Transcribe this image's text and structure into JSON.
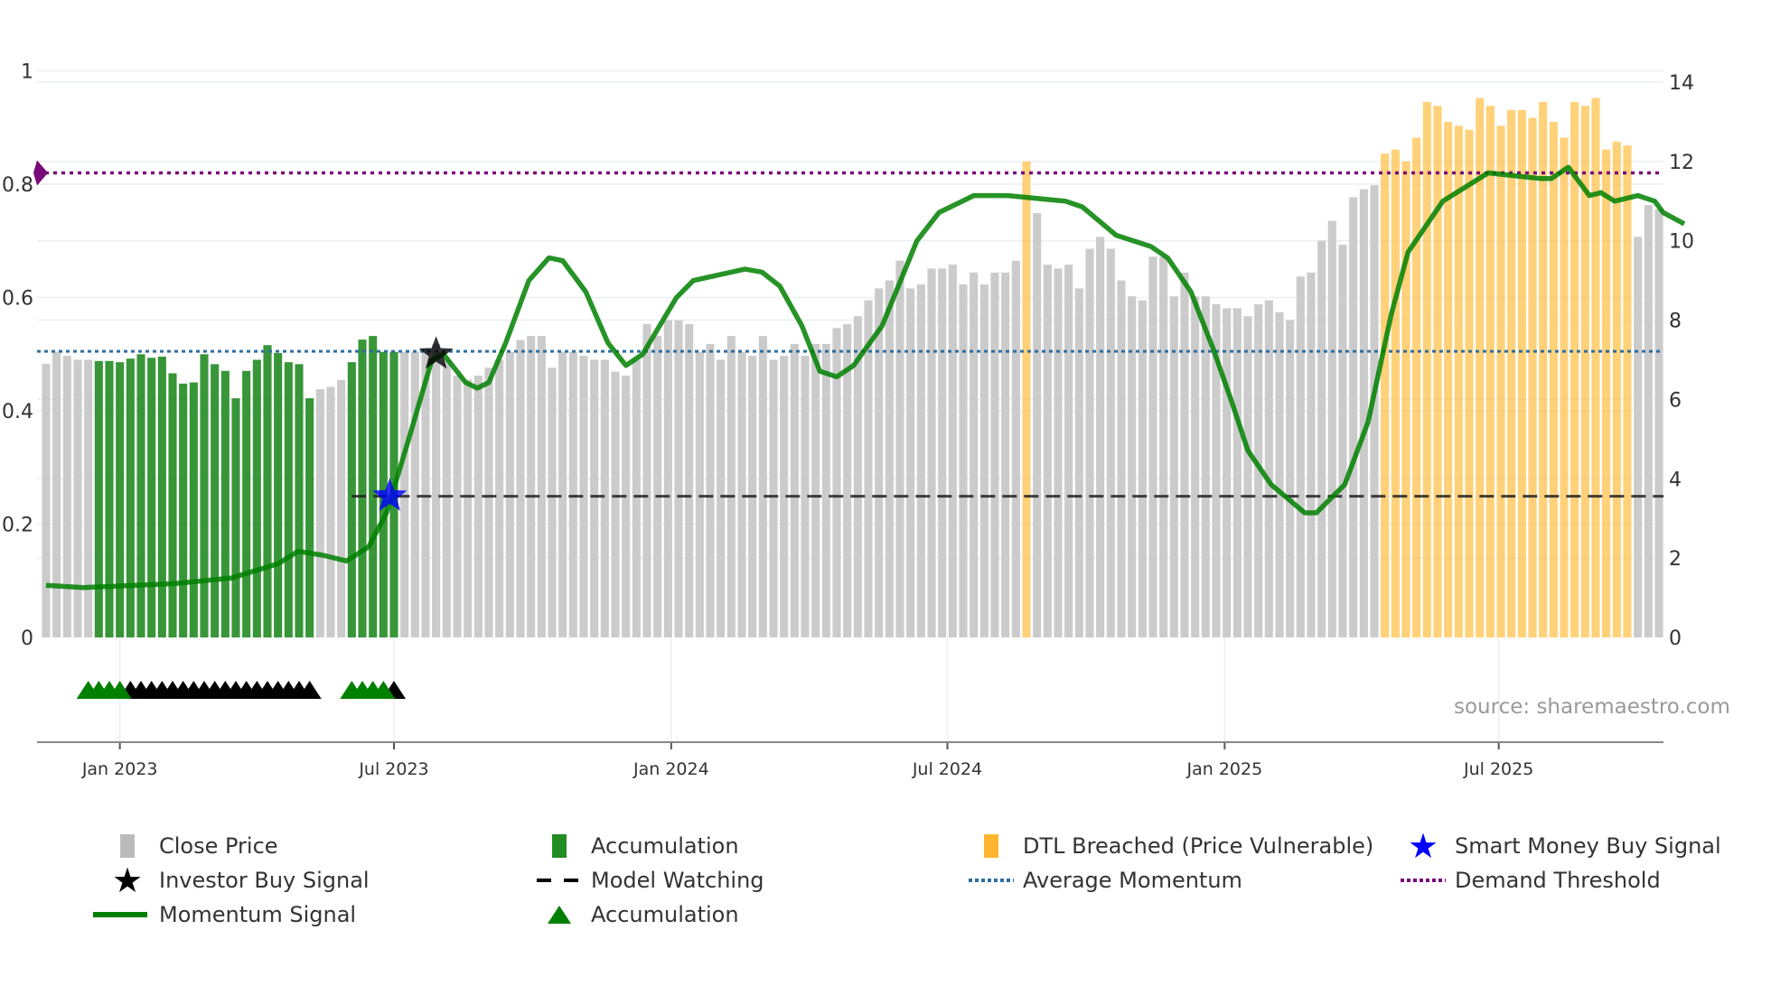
{
  "chart_data": {
    "type": "bar",
    "title": "",
    "start_week": "2022-11-14",
    "frequency": "weekly",
    "x_ticks": [
      {
        "label": "Jan 2023",
        "week": 7
      },
      {
        "label": "Jul 2023",
        "week": 33
      },
      {
        "label": "Jan 2024",
        "week": 59.3
      },
      {
        "label": "Jul 2024",
        "week": 85.5
      },
      {
        "label": "Jan 2025",
        "week": 111.8
      },
      {
        "label": "Jul 2025",
        "week": 137.8
      }
    ],
    "left_axis": {
      "ylim": [
        0,
        1
      ],
      "ticks": [
        "0",
        "0.2",
        "0.4",
        "0.6",
        "0.8",
        "1"
      ]
    },
    "right_axis": {
      "ylim": [
        0,
        14
      ],
      "ticks": [
        "0",
        "2",
        "4",
        "6",
        "8",
        "10",
        "12",
        "14"
      ]
    },
    "prices": [
      6.9,
      7.2,
      7.1,
      7.0,
      7.0,
      6.97,
      6.97,
      6.94,
      7.03,
      7.14,
      7.05,
      7.08,
      6.66,
      6.4,
      6.43,
      7.14,
      6.89,
      6.72,
      6.03,
      6.72,
      7.0,
      7.37,
      7.17,
      6.94,
      6.89,
      6.03,
      6.26,
      6.32,
      6.49,
      6.94,
      7.51,
      7.6,
      7.2,
      7.2,
      7.2,
      7.2,
      7.3,
      7.4,
      7.0,
      6.6,
      6.5,
      6.6,
      6.8,
      7.0,
      7.2,
      7.5,
      7.6,
      7.6,
      6.8,
      7.2,
      7.2,
      7.1,
      7.0,
      7.0,
      6.7,
      6.6,
      7.0,
      7.9,
      7.6,
      8.0,
      8.0,
      7.9,
      7.2,
      7.4,
      7.0,
      7.6,
      7.2,
      7.1,
      7.6,
      7.0,
      7.1,
      7.4,
      7.1,
      7.4,
      7.4,
      7.8,
      7.9,
      8.1,
      8.5,
      8.8,
      9.0,
      9.5,
      8.8,
      8.9,
      9.3,
      9.3,
      9.4,
      8.9,
      9.2,
      8.9,
      9.2,
      9.2,
      9.5,
      12.0,
      10.7,
      9.4,
      9.3,
      9.4,
      8.8,
      9.8,
      10.1,
      9.8,
      9.0,
      8.6,
      8.5,
      9.6,
      9.6,
      8.6,
      9.2,
      8.6,
      8.6,
      8.4,
      8.3,
      8.3,
      8.1,
      8.4,
      8.5,
      8.2,
      8.0,
      9.1,
      9.2,
      10.0,
      10.5,
      9.9,
      11.1,
      11.3,
      11.4,
      12.2,
      12.3,
      12.0,
      12.6,
      13.5,
      13.4,
      13.0,
      12.9,
      12.8,
      13.6,
      13.4,
      12.9,
      13.3,
      13.3,
      13.1,
      13.5,
      13.0,
      12.6,
      13.5,
      13.4,
      13.6,
      12.3,
      12.5,
      12.4,
      10.1,
      10.9,
      10.8
    ],
    "bar_categories": {
      "accumulation_weeks": [
        [
          5,
          25
        ],
        [
          29,
          33
        ]
      ],
      "dtl_breached_weeks": [
        [
          93,
          93
        ],
        [
          127,
          150
        ]
      ]
    },
    "momentum": [
      [
        0,
        0.092
      ],
      [
        3.5,
        0.088
      ],
      [
        12.2,
        0.095
      ],
      [
        17.6,
        0.105
      ],
      [
        22,
        0.13
      ],
      [
        23.9,
        0.152
      ],
      [
        26.3,
        0.145
      ],
      [
        28.5,
        0.135
      ],
      [
        30.6,
        0.16
      ],
      [
        32.3,
        0.22
      ],
      [
        34.4,
        0.35
      ],
      [
        36.6,
        0.49
      ],
      [
        37.7,
        0.5
      ],
      [
        39.8,
        0.45
      ],
      [
        40.9,
        0.44
      ],
      [
        42,
        0.45
      ],
      [
        43.6,
        0.52
      ],
      [
        45.8,
        0.63
      ],
      [
        47.7,
        0.67
      ],
      [
        49,
        0.665
      ],
      [
        51.2,
        0.61
      ],
      [
        53.3,
        0.52
      ],
      [
        55,
        0.48
      ],
      [
        56.6,
        0.5
      ],
      [
        59.8,
        0.6
      ],
      [
        61.4,
        0.63
      ],
      [
        66.3,
        0.65
      ],
      [
        67.9,
        0.645
      ],
      [
        69.6,
        0.62
      ],
      [
        71.7,
        0.55
      ],
      [
        73.4,
        0.47
      ],
      [
        75,
        0.46
      ],
      [
        76.6,
        0.48
      ],
      [
        79.3,
        0.55
      ],
      [
        82.6,
        0.7
      ],
      [
        84.7,
        0.75
      ],
      [
        88,
        0.78
      ],
      [
        91.2,
        0.78
      ],
      [
        96.7,
        0.77
      ],
      [
        98.3,
        0.76
      ],
      [
        101.5,
        0.71
      ],
      [
        104.8,
        0.69
      ],
      [
        106.4,
        0.67
      ],
      [
        108.6,
        0.61
      ],
      [
        110.7,
        0.51
      ],
      [
        112.4,
        0.42
      ],
      [
        114,
        0.33
      ],
      [
        116.2,
        0.27
      ],
      [
        119.4,
        0.22
      ],
      [
        120.5,
        0.22
      ],
      [
        123.2,
        0.27
      ],
      [
        125.4,
        0.38
      ],
      [
        127.6,
        0.57
      ],
      [
        129.2,
        0.68
      ],
      [
        132.5,
        0.77
      ],
      [
        136.8,
        0.82
      ],
      [
        141.7,
        0.81
      ],
      [
        142.8,
        0.81
      ],
      [
        144.4,
        0.83
      ],
      [
        146.4,
        0.78
      ],
      [
        147.5,
        0.785
      ],
      [
        148.8,
        0.77
      ],
      [
        151,
        0.78
      ],
      [
        152.6,
        0.77
      ],
      [
        153.4,
        0.75
      ],
      [
        155.4,
        0.73
      ]
    ],
    "demand_threshold": 0.82,
    "average_momentum": 0.505,
    "model_watching": {
      "value_right_axis": 3.56,
      "from_week": 29
    },
    "investor_buy_signal": {
      "week": 37,
      "value": 0.5
    },
    "smart_money_buy_signal": {
      "week": 32.6,
      "value_right_axis": 3.56
    },
    "accumulation_markers": {
      "green_weeks": [
        4,
        5,
        6,
        7,
        29,
        30,
        31,
        32
      ],
      "black_weeks": [
        8,
        9,
        10,
        11,
        12,
        13,
        14,
        15,
        16,
        17,
        18,
        19,
        20,
        21,
        22,
        23,
        24,
        25,
        33
      ]
    },
    "colors": {
      "close": "#c8c8c8",
      "accumulation": "#228b22",
      "dtl": "#ffbe40",
      "momentum": "#008000",
      "avg": "#2e6fa0",
      "demand": "#7a0a7a",
      "watch": "#222222",
      "smart": "#0000ff"
    },
    "legend": [
      {
        "label": "Close Price",
        "icon": "gray-bar"
      },
      {
        "label": "Accumulation",
        "icon": "green-bar"
      },
      {
        "label": "DTL Breached (Price Vulnerable)",
        "icon": "orange-bar"
      },
      {
        "label": "Smart Money Buy Signal",
        "icon": "blue-star"
      },
      {
        "label": "Investor Buy Signal",
        "icon": "black-star"
      },
      {
        "label": "Model Watching",
        "icon": "dashed-line"
      },
      {
        "label": "Average Momentum",
        "icon": "blue-dotted-line"
      },
      {
        "label": "Demand Threshold",
        "icon": "purple-dotted-line"
      },
      {
        "label": "Momentum Signal",
        "icon": "green-line"
      },
      {
        "label": "Accumulation",
        "icon": "green-triangle"
      }
    ],
    "source": "source: sharemaestro.com"
  }
}
